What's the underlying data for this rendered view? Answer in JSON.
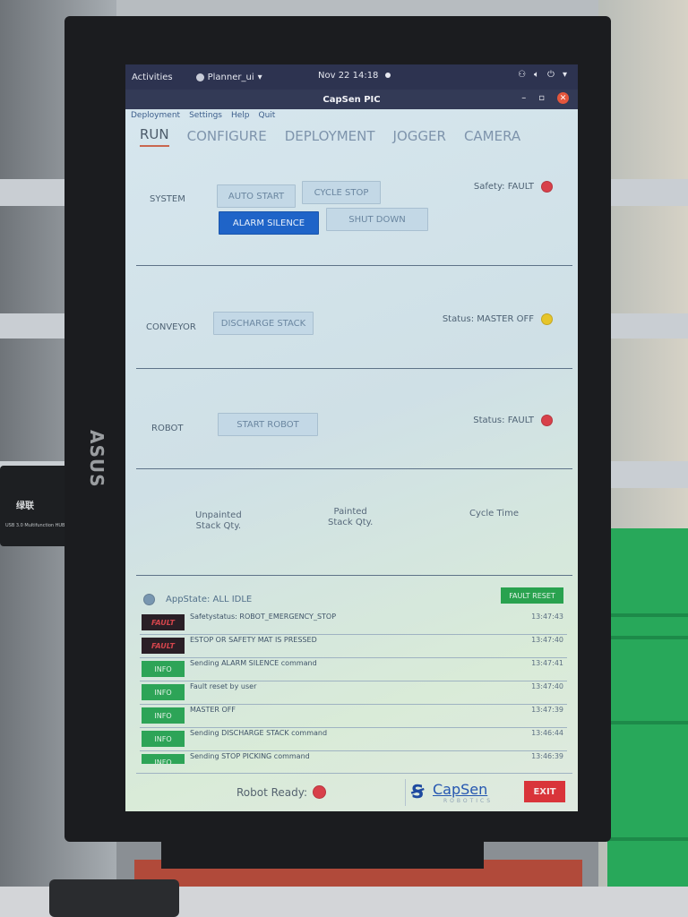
{
  "desktop": {
    "activities_label": "Activities",
    "app_menu_label": "Planner_ui",
    "clock": "Nov 22  14:18",
    "tray_icons": [
      "network-icon",
      "volume-icon",
      "power-icon",
      "dropdown-icon"
    ]
  },
  "window": {
    "title": "CapSen PIC",
    "controls": [
      "minimize",
      "restore",
      "close"
    ]
  },
  "menubar": [
    "Deployment",
    "Settings",
    "Help",
    "Quit"
  ],
  "tabs": [
    {
      "label": "RUN",
      "active": true
    },
    {
      "label": "CONFIGURE",
      "active": false
    },
    {
      "label": "DEPLOYMENT",
      "active": false
    },
    {
      "label": "JOGGER",
      "active": false
    },
    {
      "label": "CAMERA",
      "active": false
    }
  ],
  "system": {
    "label": "SYSTEM",
    "buttons": {
      "auto_start": "AUTO START",
      "cycle_stop": "CYCLE STOP",
      "alarm_silence": "ALARM SILENCE",
      "shut_down": "SHUT DOWN"
    },
    "status_text": "Safety: FAULT",
    "status_color": "#d8404a"
  },
  "conveyor": {
    "label": "CONVEYOR",
    "button": "DISCHARGE STACK",
    "status_text": "Status: MASTER OFF",
    "status_color": "#e6c52a"
  },
  "robot": {
    "label": "ROBOT",
    "button": "START ROBOT",
    "status_text": "Status: FAULT",
    "status_color": "#d8404a"
  },
  "stats": {
    "unpainted": "Unpainted\nStack Qty.",
    "painted": "Painted\nStack Qty.",
    "cycle_time": "Cycle Time"
  },
  "log": {
    "appstate": "AppState: ALL IDLE",
    "fault_reset": "FAULT RESET",
    "entries": [
      {
        "level": "FAULT",
        "message": "Safetystatus: ROBOT_EMERGENCY_STOP",
        "time": "13:47:43"
      },
      {
        "level": "FAULT",
        "message": "ESTOP OR SAFETY MAT IS PRESSED",
        "time": "13:47:40"
      },
      {
        "level": "INFO",
        "message": "Sending ALARM SILENCE command",
        "time": "13:47:41"
      },
      {
        "level": "INFO",
        "message": "Fault reset by user",
        "time": "13:47:40"
      },
      {
        "level": "INFO",
        "message": "MASTER OFF",
        "time": "13:47:39"
      },
      {
        "level": "INFO",
        "message": "Sending DISCHARGE STACK command",
        "time": "13:46:44"
      },
      {
        "level": "INFO",
        "message": "Sending STOP PICKING command",
        "time": "13:46:39"
      }
    ]
  },
  "footer": {
    "robot_ready_label": "Robot Ready:",
    "robot_ready_color": "#d8404a",
    "logo_name": "CapSen",
    "logo_sub": "ROBOTICS",
    "exit_label": "EXIT"
  },
  "hardware": {
    "monitor_brand": "ASUS",
    "usb_hub_brand": "绿联",
    "usb_hub_label": "USB 3.0 Multifunction HUB"
  }
}
